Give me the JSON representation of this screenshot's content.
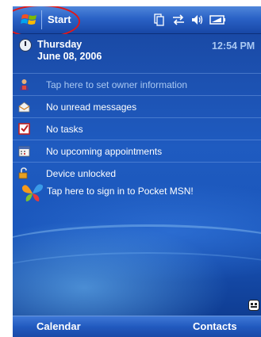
{
  "titlebar": {
    "start_label": "Start",
    "icons": [
      "sync-icon",
      "connectivity-icon",
      "volume-icon",
      "battery-icon"
    ]
  },
  "today": {
    "weekday": "Thursday",
    "date": "June 08, 2006",
    "time": "12:54 PM",
    "items": [
      {
        "icon": "owner-info-icon",
        "label": "Tap here to set owner information",
        "dim": true
      },
      {
        "icon": "messages-icon",
        "label": "No unread messages",
        "dim": false
      },
      {
        "icon": "tasks-icon",
        "label": "No tasks",
        "dim": false
      },
      {
        "icon": "calendar-icon",
        "label": "No upcoming appointments",
        "dim": false
      },
      {
        "icon": "lock-icon",
        "label": "Device unlocked",
        "dim": false
      }
    ],
    "msn_label": "Tap here to sign in to Pocket MSN!"
  },
  "menubar": {
    "left_softkey": "Calendar",
    "right_softkey": "Contacts"
  },
  "colors": {
    "highlight_circle": "#e01818",
    "background_blue": "#1f5bc0"
  }
}
